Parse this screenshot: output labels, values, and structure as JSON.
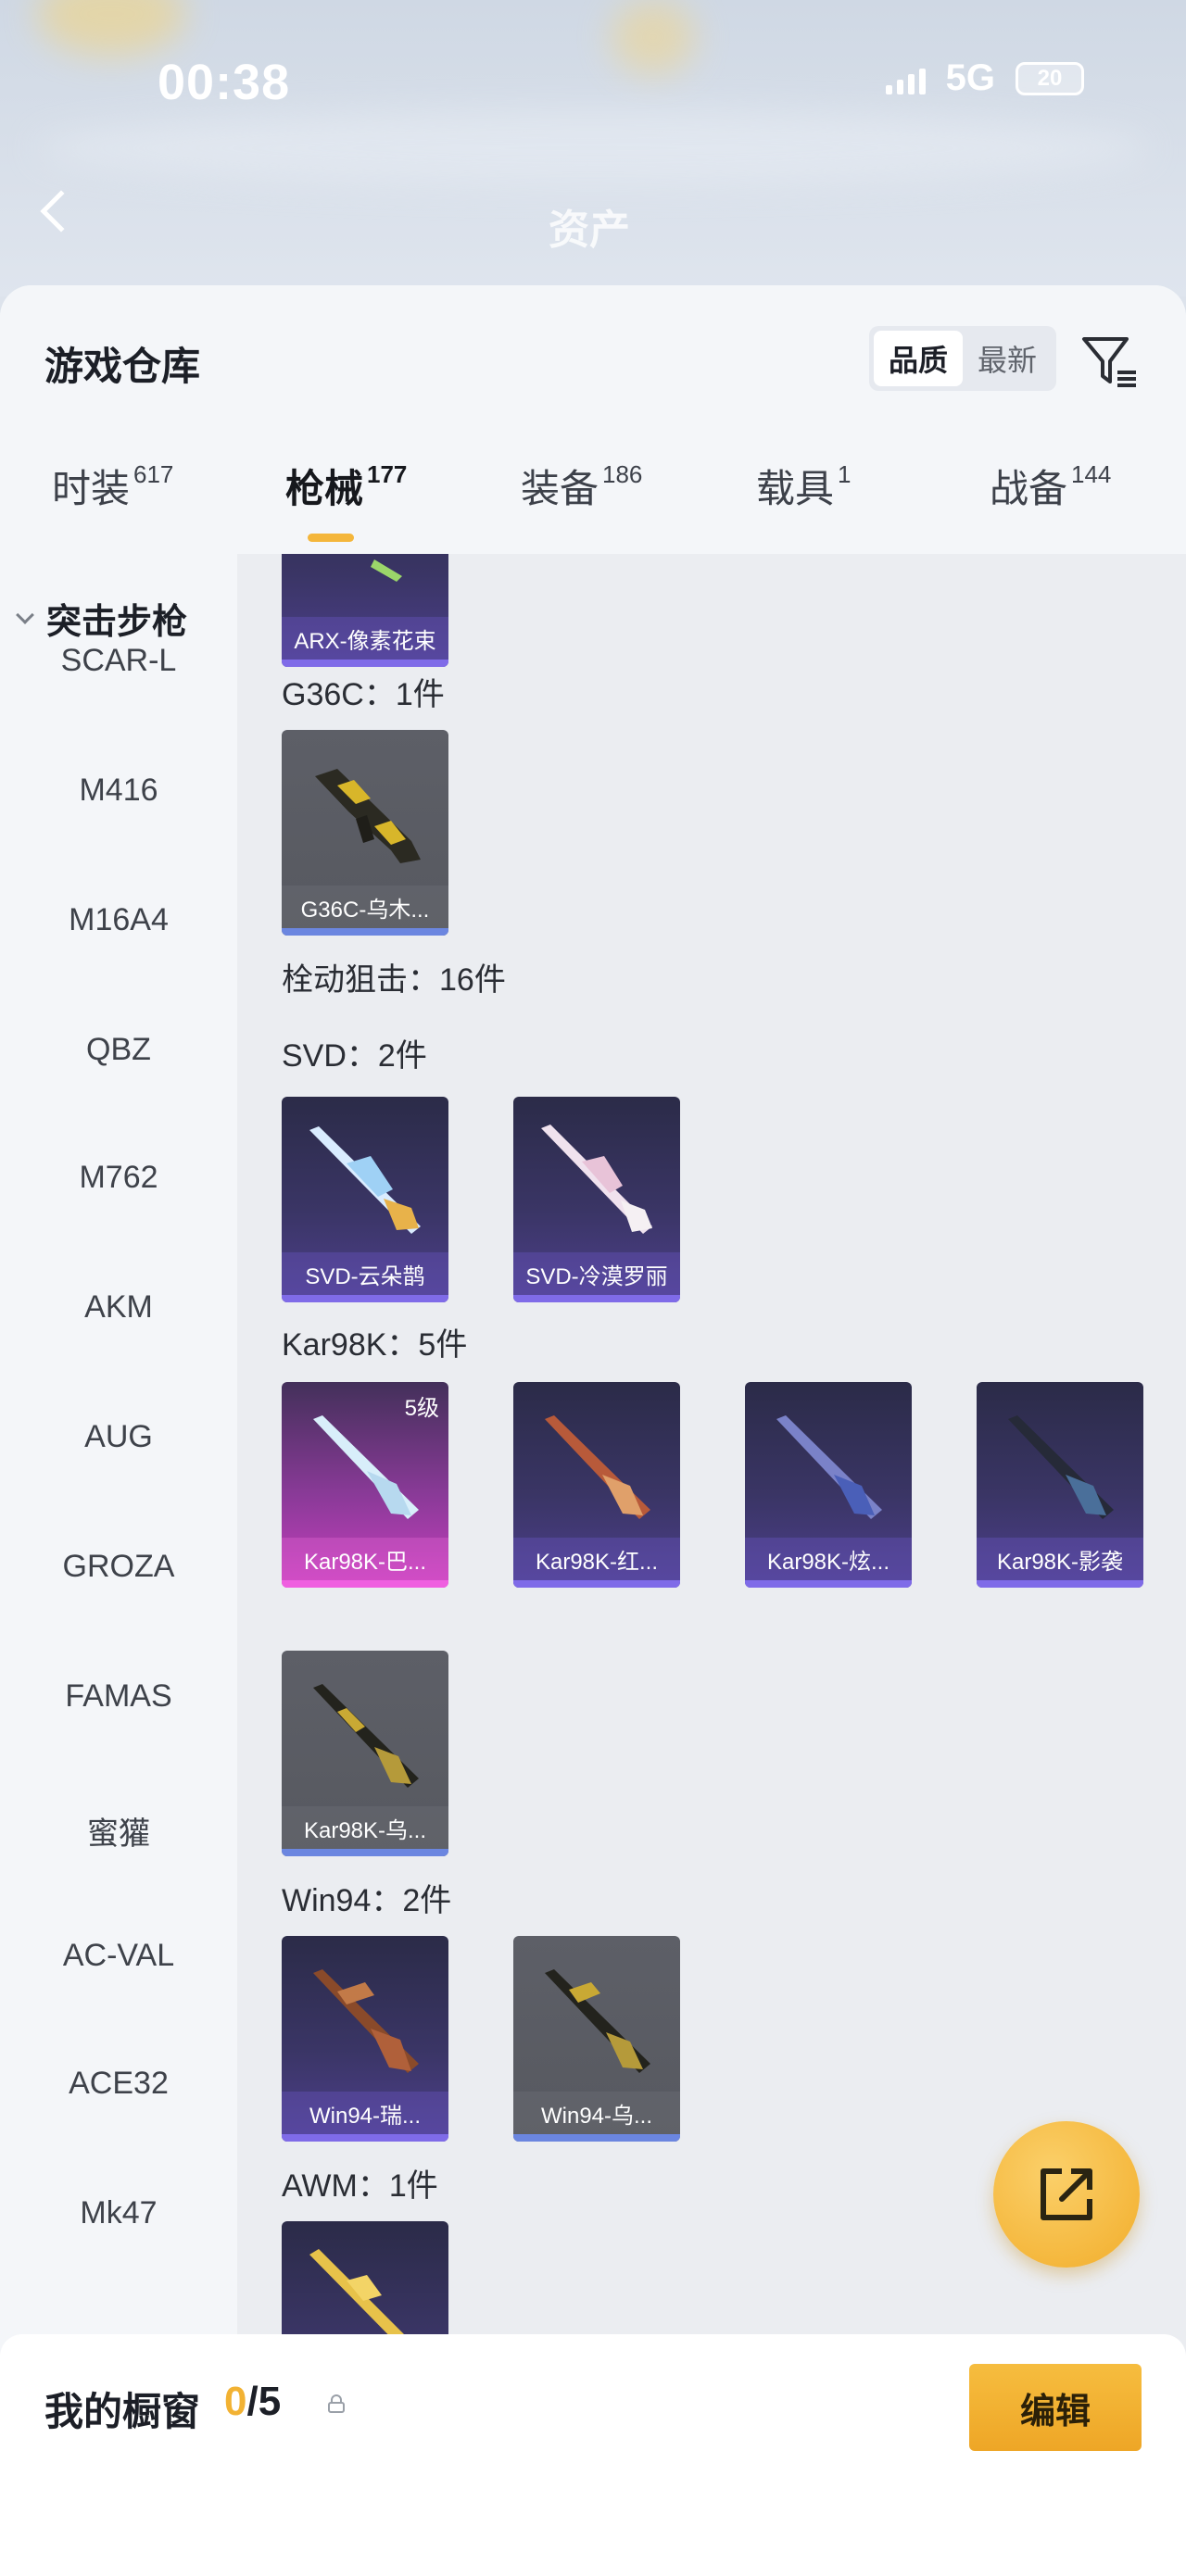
{
  "status_bar": {
    "time": "00:38",
    "network": "5G",
    "battery": "20"
  },
  "background": {
    "asset_title": "资产"
  },
  "header": {
    "title": "游戏仓库",
    "sort": {
      "options": [
        "品质",
        "最新"
      ],
      "selected": "品质"
    }
  },
  "tabs": [
    {
      "label": "时装",
      "count": "617"
    },
    {
      "label": "枪械",
      "count": "177",
      "active": true
    },
    {
      "label": "装备",
      "count": "186"
    },
    {
      "label": "载具",
      "count": "1"
    },
    {
      "label": "战备",
      "count": "144"
    }
  ],
  "sidebar": {
    "group": "突击步枪",
    "items": [
      "SCAR-L",
      "M416",
      "M16A4",
      "QBZ",
      "M762",
      "AKM",
      "AUG",
      "GROZA",
      "FAMAS",
      "蜜獾",
      "AC-VAL",
      "ACE32",
      "Mk47"
    ]
  },
  "content": {
    "sections": [
      {
        "title": "G36C：1件"
      },
      {
        "title": "栓动狙击：16件"
      },
      {
        "title": "SVD：2件"
      },
      {
        "title": "Kar98K：5件"
      },
      {
        "title": "Win94：2件"
      },
      {
        "title": "AWM：1件"
      }
    ],
    "cards": {
      "arx": {
        "label": "ARX-像素花束"
      },
      "g36c": {
        "label": "G36C-乌木..."
      },
      "svd1": {
        "label": "SVD-云朵鹊"
      },
      "svd2": {
        "label": "SVD-冷漠罗丽"
      },
      "kar1": {
        "label": "Kar98K-巴...",
        "level": "5级"
      },
      "kar2": {
        "label": "Kar98K-红..."
      },
      "kar3": {
        "label": "Kar98K-炫..."
      },
      "kar4": {
        "label": "Kar98K-影袭"
      },
      "kar5": {
        "label": "Kar98K-乌..."
      },
      "win1": {
        "label": "Win94-瑞..."
      },
      "win2": {
        "label": "Win94-乌..."
      }
    }
  },
  "showcase": {
    "label": "我的橱窗",
    "current": "0",
    "total": "/5",
    "edit_label": "编辑"
  },
  "colors": {
    "accent": "#f2b233",
    "tab_underline": "#f4b63b",
    "card_purple": "#4d3f8c",
    "card_grey": "#5d5f67",
    "card_pink": "#c63fbd"
  }
}
